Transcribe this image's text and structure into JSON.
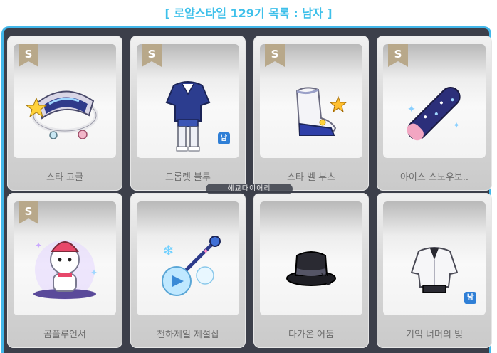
{
  "title": "[ 로얄스타일 129기 목록 : 남자 ]",
  "watermark": "헤교다이어리",
  "grade_badge": "S",
  "gender_badge": "남",
  "colors": {
    "accent": "#42b7ea",
    "panel_bg": "#3c3f4a",
    "gender_badge": "#2f7fd6",
    "grade_badge": "#b8a88a"
  },
  "items": [
    {
      "name": "스타 고글",
      "icon": "star-goggles-icon",
      "grade": true,
      "gender": false
    },
    {
      "name": "드롭렛 블루",
      "icon": "droplet-blue-outfit-icon",
      "grade": true,
      "gender": true
    },
    {
      "name": "스타 벨 부츠",
      "icon": "star-bell-boots-icon",
      "grade": true,
      "gender": false
    },
    {
      "name": "아이스 스노우보..",
      "icon": "ice-snowboard-icon",
      "grade": true,
      "gender": false
    },
    {
      "name": "곰플루언서",
      "icon": "bear-influencer-icon",
      "grade": true,
      "gender": false
    },
    {
      "name": "천하제일 제설삽",
      "icon": "snow-shovel-icon",
      "grade": false,
      "gender": false
    },
    {
      "name": "다가온 어둠",
      "icon": "dark-top-hat-icon",
      "grade": false,
      "gender": false
    },
    {
      "name": "기억 너머의 빛",
      "icon": "white-outfit-icon",
      "grade": false,
      "gender": true
    }
  ]
}
